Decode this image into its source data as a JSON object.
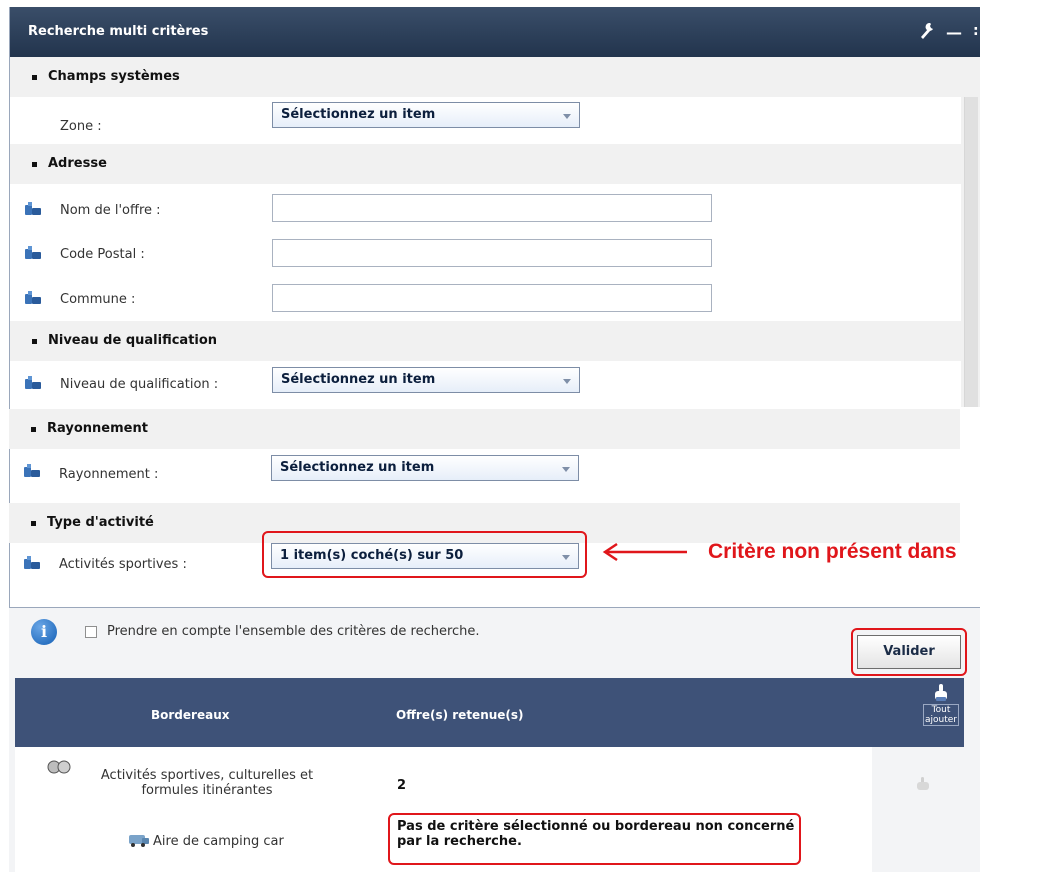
{
  "window": {
    "title": "Recherche multi critères",
    "controls": [
      "wrench-icon",
      "minimize-icon",
      "more-icon"
    ]
  },
  "sections": [
    {
      "title": "Champs systèmes"
    },
    {
      "title": "Adresse"
    },
    {
      "title": "Niveau de qualification"
    },
    {
      "title": "Rayonnement"
    },
    {
      "title": "Type d'activité"
    }
  ],
  "fields": {
    "zone": {
      "label": "Zone :",
      "value": "Sélectionnez un item"
    },
    "nom_offre": {
      "label": "Nom de l'offre :",
      "value": ""
    },
    "code_postal": {
      "label": "Code Postal :",
      "value": ""
    },
    "commune": {
      "label": "Commune :",
      "value": ""
    },
    "niveau_qualification": {
      "label": "Niveau de qualification :",
      "value": "Sélectionnez un item"
    },
    "rayonnement": {
      "label": "Rayonnement :",
      "value": "Sélectionnez un item"
    },
    "activites_sportives": {
      "label": "Activités sportives :",
      "value": "1 item(s) coché(s) sur 50"
    }
  },
  "options": {
    "checkbox_label": "Prendre en compte l'ensemble des critères de recherche.",
    "checkbox_checked": false,
    "validate_label": "Valider"
  },
  "table": {
    "headers": [
      "Bordereaux",
      "Offre(s) retenue(s)"
    ],
    "add_all_label": "Tout ajouter",
    "rows": [
      {
        "bordereau": "Activités sportives, culturelles et formules itinérantes",
        "offres": "2"
      },
      {
        "bordereau": "Aire de camping car",
        "offres": "Pas de critère sélectionné ou bordereau non concerné par la recherche."
      }
    ]
  },
  "annotation": {
    "text": "Critère non présent dans",
    "color": "#e0161b"
  },
  "colors": {
    "titlebar": "#2c3f5a",
    "table_header": "#3e5278",
    "annotation": "#e0161b"
  }
}
